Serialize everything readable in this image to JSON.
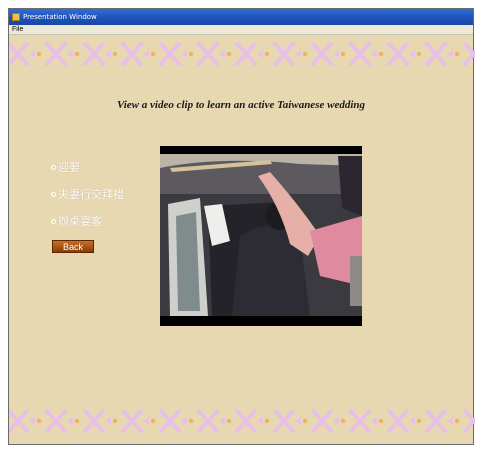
{
  "window": {
    "title": "Presentation Window",
    "menu": [
      "File"
    ]
  },
  "main": {
    "heading": "View a video clip to learn an active Taiwanese wedding",
    "options": [
      {
        "label": "迎娶"
      },
      {
        "label": "夫妻行交拜禮"
      },
      {
        "label": "辦桌宴客"
      }
    ],
    "back_label": "Back"
  },
  "icons": {
    "app": "presentation-app-icon",
    "option_marker": "bullet-circle-icon"
  },
  "colors": {
    "background": "#e8d8b2",
    "border_pattern": "#e7bfe7",
    "border_dot": "#f0b25c",
    "back_button": "#b45c14",
    "titlebar": "#1e4fb8"
  }
}
